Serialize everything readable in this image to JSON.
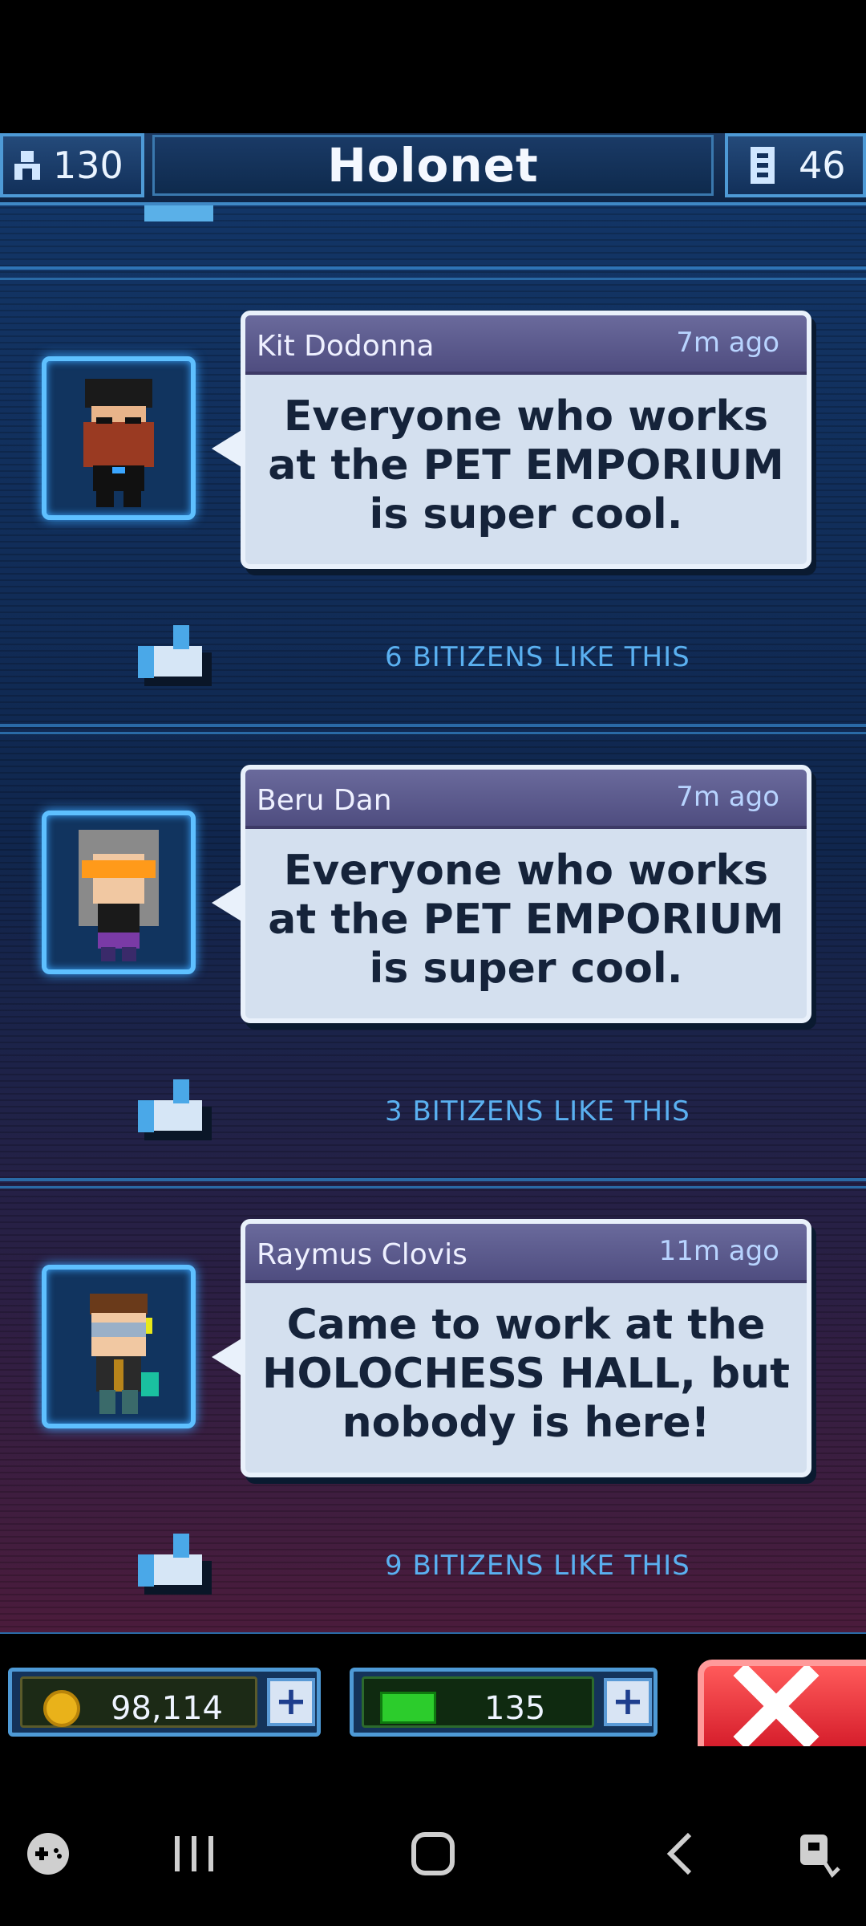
{
  "header": {
    "population": "130",
    "title": "Holonet",
    "floors": "46"
  },
  "posts": [
    {
      "author": "Kit Dodonna",
      "time": "7m ago",
      "message": "Everyone who works at the PET EMPORIUM is super cool.",
      "likes": "6 BITIZENS LIKE THIS"
    },
    {
      "author": "Beru Dan",
      "time": "7m ago",
      "message": "Everyone who works at the PET EMPORIUM is super cool.",
      "likes": "3 BITIZENS LIKE THIS"
    },
    {
      "author": "Raymus Clovis",
      "time": "11m ago",
      "message": "Came to work at the HOLOCHESS HALL, but nobody is here!",
      "likes": "9 BITIZENS LIKE THIS"
    }
  ],
  "resources": {
    "coins": "98,114",
    "bux": "135"
  },
  "colors": {
    "accent": "#5ec0ff",
    "close": "#d61e2c",
    "coin": "#e9b21a",
    "bux": "#2ccc2c"
  }
}
